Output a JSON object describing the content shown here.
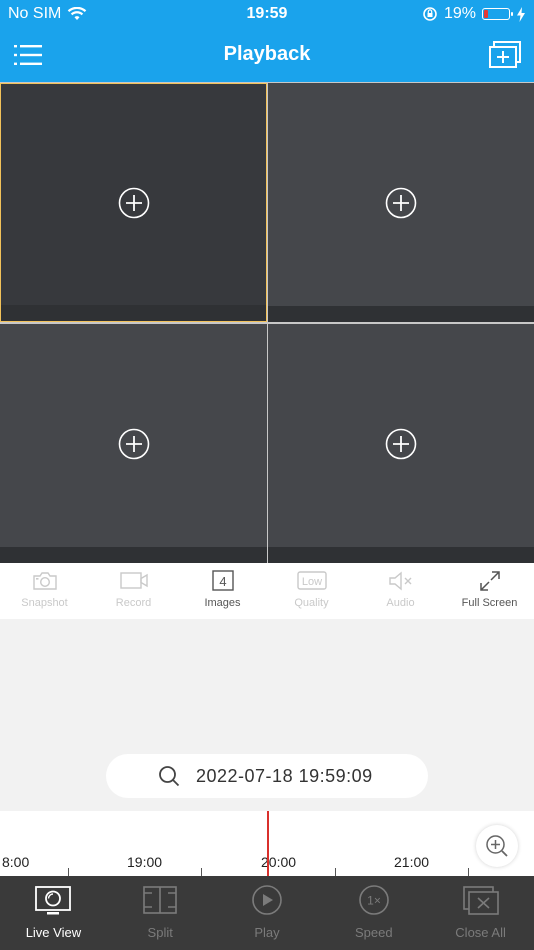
{
  "status": {
    "carrier": "No SIM",
    "time": "19:59",
    "battery": "19%",
    "battery_level": 0.19
  },
  "nav": {
    "title": "Playback",
    "menu_icon": "menu-icon",
    "add_window_icon": "add-window-icon"
  },
  "grid": {
    "cells": [
      {
        "selected": true
      },
      {
        "selected": false
      },
      {
        "selected": false
      },
      {
        "selected": false
      }
    ]
  },
  "toolbar": {
    "items": [
      {
        "label": "Snapshot",
        "icon": "camera-icon",
        "enabled": false
      },
      {
        "label": "Record",
        "icon": "video-icon",
        "enabled": false
      },
      {
        "label": "Images",
        "icon": "split-count-icon",
        "badge": "4",
        "enabled": true
      },
      {
        "label": "Quality",
        "icon": "quality-icon",
        "badge": "Low",
        "enabled": false
      },
      {
        "label": "Audio",
        "icon": "speaker-mute-icon",
        "enabled": false
      },
      {
        "label": "Full Screen",
        "icon": "fullscreen-icon",
        "enabled": true
      }
    ]
  },
  "search": {
    "datetime": "2022-07-18  19:59:09"
  },
  "timeline": {
    "labels": [
      "8:00",
      "19:00",
      "20:00",
      "21:00"
    ]
  },
  "tabbar": {
    "items": [
      {
        "label": "Live View",
        "icon": "live-view-icon",
        "active": true
      },
      {
        "label": "Split",
        "icon": "split-icon",
        "active": false
      },
      {
        "label": "Play",
        "icon": "play-icon",
        "active": false
      },
      {
        "label": "Speed",
        "icon": "speed-icon",
        "badge": "1×",
        "active": false
      },
      {
        "label": "Close All",
        "icon": "close-all-icon",
        "active": false
      }
    ]
  },
  "colors": {
    "header": "#1aa3ec",
    "selected_border": "#f2c25a",
    "timeline_cursor": "#d9302c",
    "tabbar": "#3a3a3a"
  }
}
